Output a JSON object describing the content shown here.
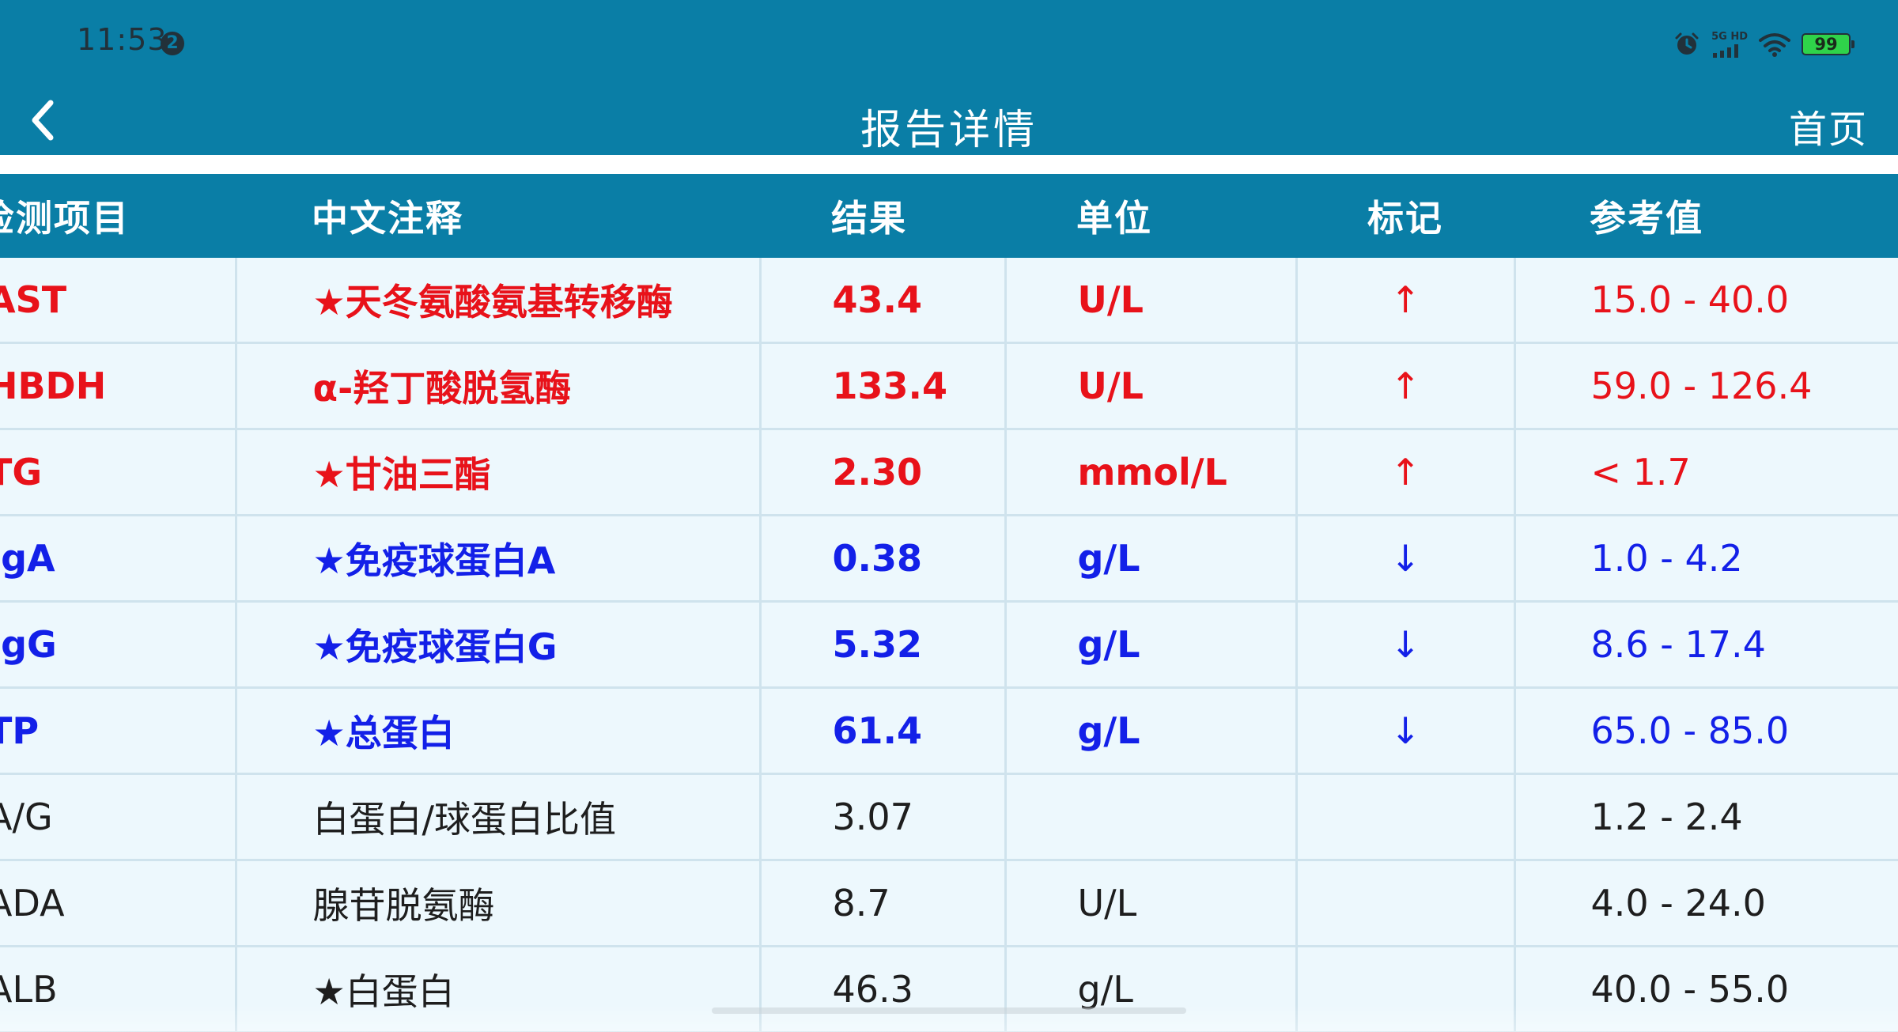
{
  "status_bar": {
    "time": "11:53",
    "badge": "2",
    "network_label": "5G HD",
    "battery": "99"
  },
  "header": {
    "title": "报告详情",
    "home_label": "首页",
    "back_icon": "chevron-left-icon"
  },
  "colors": {
    "primary": "#0a7ea6",
    "row_background": "#edf8fd",
    "high": "#e8121a",
    "low": "#1320e8",
    "normal": "#1e1e1e"
  },
  "table": {
    "columns": [
      "检测项目",
      "中文注释",
      "结果",
      "单位",
      "标记",
      "参考值"
    ],
    "rows": [
      {
        "status": "high",
        "code": "AST",
        "name": "★天冬氨酸氨基转移酶",
        "result": "43.4",
        "unit": "U/L",
        "flag": "↑",
        "ref": "15.0 - 40.0"
      },
      {
        "status": "high",
        "code": "HBDH",
        "name": "α-羟丁酸脱氢酶",
        "result": "133.4",
        "unit": "U/L",
        "flag": "↑",
        "ref": "59.0 - 126.4"
      },
      {
        "status": "high",
        "code": "TG",
        "name": "★甘油三酯",
        "result": "2.30",
        "unit": "mmol/L",
        "flag": "↑",
        "ref": "< 1.7"
      },
      {
        "status": "low",
        "code": "IgA",
        "name": "★免疫球蛋白A",
        "result": "0.38",
        "unit": "g/L",
        "flag": "↓",
        "ref": "1.0 - 4.2"
      },
      {
        "status": "low",
        "code": "IgG",
        "name": "★免疫球蛋白G",
        "result": "5.32",
        "unit": "g/L",
        "flag": "↓",
        "ref": "8.6 - 17.4"
      },
      {
        "status": "low",
        "code": "TP",
        "name": "★总蛋白",
        "result": "61.4",
        "unit": "g/L",
        "flag": "↓",
        "ref": "65.0 - 85.0"
      },
      {
        "status": "normal",
        "code": "A/G",
        "name": "白蛋白/球蛋白比值",
        "result": "3.07",
        "unit": "",
        "flag": "",
        "ref": "1.2 - 2.4"
      },
      {
        "status": "normal",
        "code": "ADA",
        "name": "腺苷脱氨酶",
        "result": "8.7",
        "unit": "U/L",
        "flag": "",
        "ref": "4.0 - 24.0"
      },
      {
        "status": "normal",
        "code": "ALB",
        "name": "★白蛋白",
        "result": "46.3",
        "unit": "g/L",
        "flag": "",
        "ref": "40.0 - 55.0"
      }
    ]
  }
}
